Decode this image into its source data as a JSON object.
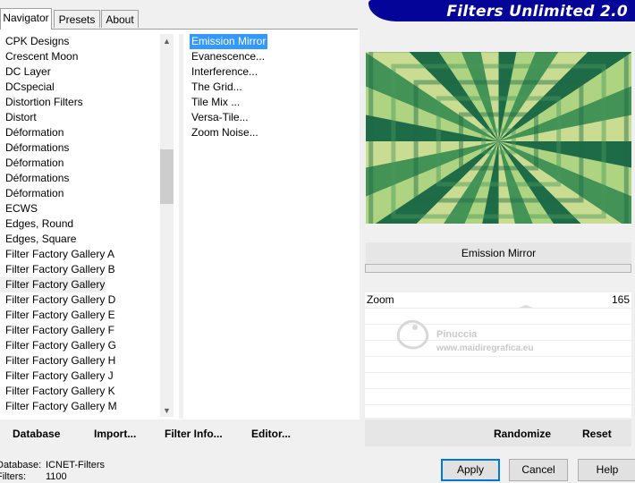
{
  "app": {
    "title": "Filters Unlimited 2.0"
  },
  "tabs": [
    {
      "label": "Navigator",
      "active": true
    },
    {
      "label": "Presets",
      "active": false
    },
    {
      "label": "About",
      "active": false
    }
  ],
  "categories": [
    "CPK Designs",
    "Crescent Moon",
    "DC Layer",
    "DCspecial",
    "Distortion Filters",
    "Distort",
    "Déformation",
    "Déformations",
    "Déformation",
    "Déformations",
    "Déformation",
    "ECWS",
    "Edges, Round",
    "Edges, Square",
    "Filter Factory Gallery A",
    "Filter Factory Gallery B",
    "Filter Factory Gallery C",
    "Filter Factory Gallery D",
    "Filter Factory Gallery E",
    "Filter Factory Gallery F",
    "Filter Factory Gallery G",
    "Filter Factory Gallery H",
    "Filter Factory Gallery J",
    "Filter Factory Gallery K",
    "Filter Factory Gallery M"
  ],
  "selected_category": "Filter Factory Gallery C",
  "filters": [
    "Emission Mirror",
    "Evanescence...",
    "Interference...",
    "The Grid...",
    "Tile Mix ...",
    "Versa-Tile...",
    "Zoom Noise..."
  ],
  "selected_filter": "Emission Mirror",
  "preview": {
    "filter_name": "Emission Mirror",
    "colors": [
      "#1f6b48",
      "#c8e68c",
      "#4a9a5a",
      "#e8f0a0"
    ]
  },
  "params": [
    {
      "name": "Zoom",
      "value": "165"
    }
  ],
  "watermark": {
    "name": "Pinuccia",
    "url": "www.maidiregrafica.eu"
  },
  "bottom_links": {
    "database": "Database",
    "import": "Import...",
    "filter_info": "Filter Info...",
    "editor": "Editor..."
  },
  "right_actions": {
    "randomize": "Randomize",
    "reset": "Reset"
  },
  "status": {
    "database_label": "Database:",
    "database_value": "ICNET-Filters",
    "filters_label": "Filters:",
    "filters_value": "1100"
  },
  "buttons": {
    "apply": "Apply",
    "cancel": "Cancel",
    "help": "Help"
  }
}
